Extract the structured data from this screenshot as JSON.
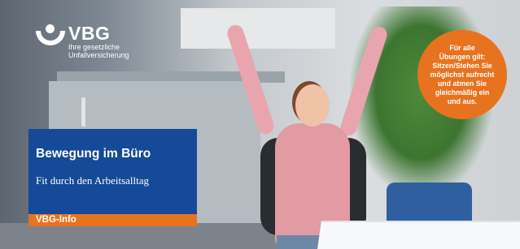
{
  "logo": {
    "name": "VBG",
    "tagline": "Ihre gesetzliche\nUnfallversicherung"
  },
  "callout": {
    "text": "Für alle\nÜbungen gilt:\nSitzen/Stehen Sie\nmöglichst aufrecht\nund atmen Sie\ngleichmäßig ein\nund aus."
  },
  "title_box": {
    "title": "Bewegung im Büro",
    "subtitle": "Fit durch den Arbeitsalltag"
  },
  "label": {
    "text": "VBG-Info"
  },
  "colors": {
    "brand_blue": "#144a97",
    "accent_orange": "#e8731e"
  }
}
